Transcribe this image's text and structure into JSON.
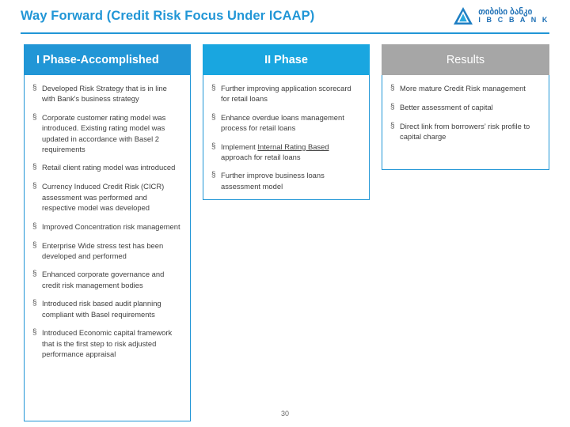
{
  "header": {
    "title": "Way Forward (Credit Risk Focus Under ICAAP)",
    "logo": {
      "geo_text": "თიბისი ბანკი",
      "latin_text": "I B C  B A N K"
    }
  },
  "columns": [
    {
      "heading": "I Phase-Accomplished",
      "bullets": [
        "Developed Risk Strategy  that is in line with Bank's business strategy",
        "Corporate customer rating model was introduced. Existing rating model was updated in accordance with Basel 2 requirements",
        "Retail client rating model was introduced",
        "Currency Induced Credit Risk (CICR) assessment was performed and respective model was developed",
        "Improved Concentration risk management",
        "Enterprise Wide stress test has been developed and performed",
        "Enhanced corporate governance and credit risk management bodies",
        "Introduced risk based audit planning compliant with Basel requirements",
        "Introduced Economic capital framework that is the first step to risk adjusted performance appraisal"
      ]
    },
    {
      "heading": "II Phase",
      "bullets": [
        "Further improving application scorecard for retail loans",
        "Enhance overdue loans management process for retail loans",
        "Implement Internal Rating Based approach for retail loans",
        "Further improve business loans assessment model"
      ],
      "underlined_phrases": [
        "Internal Rating Based"
      ]
    },
    {
      "heading": "Results",
      "bullets": [
        "More mature Credit Risk management",
        "Better assessment of capital",
        "Direct link from borrowers’ risk profile to capital charge"
      ]
    }
  ],
  "bullet_glyph": "§",
  "footer": {
    "page_number": "30"
  },
  "colors": {
    "accent_blue": "#2196d6",
    "phase2_blue": "#19a6e0",
    "results_gray": "#a6a6a6"
  }
}
